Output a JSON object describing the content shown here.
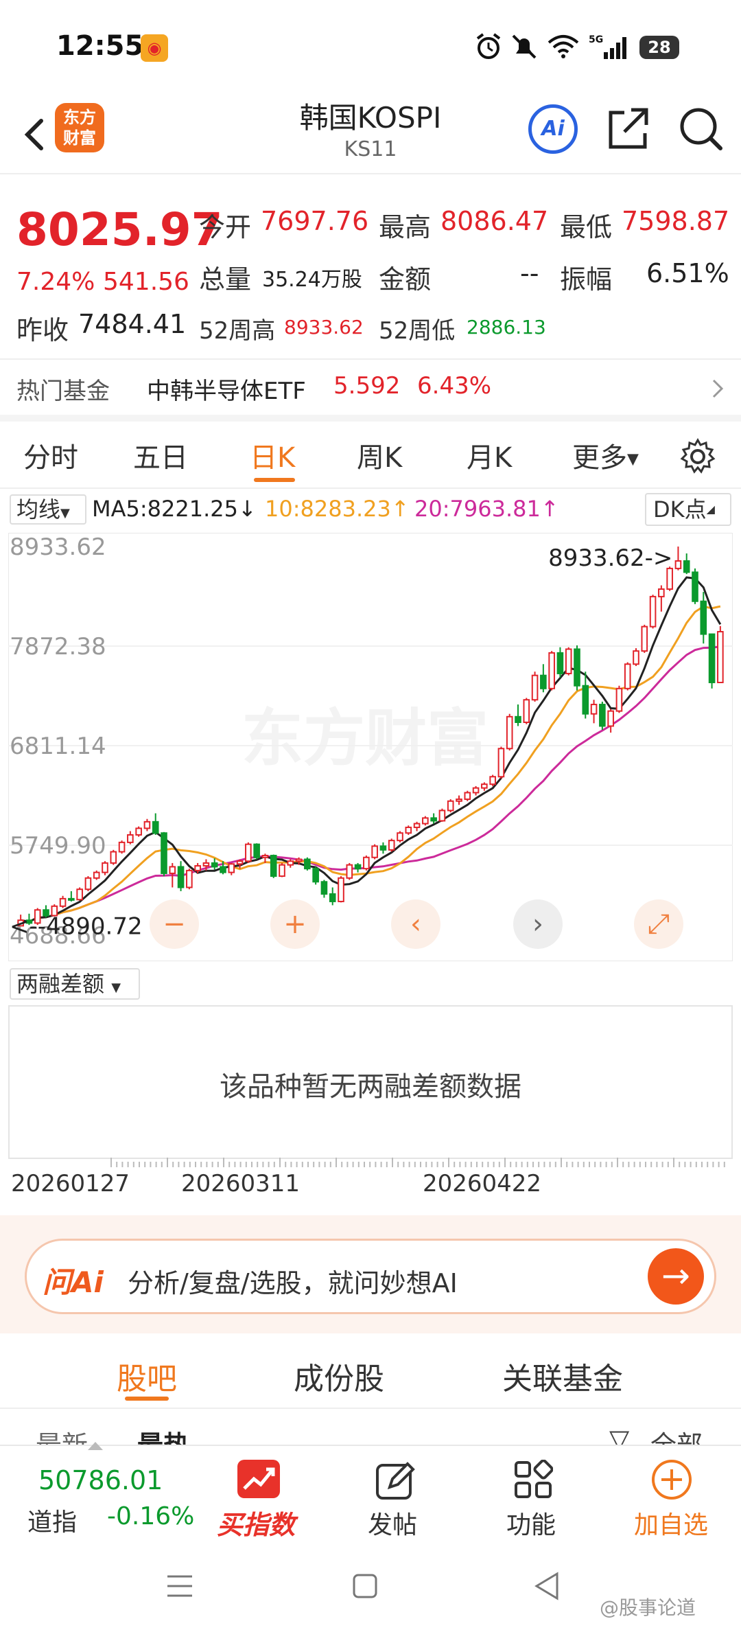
{
  "status_bar": {
    "time": "12:55",
    "battery": "28"
  },
  "header": {
    "logo_text": "东方\n财富",
    "title": "韩国KOSPI",
    "code": "KS11",
    "ai_label": "Ai"
  },
  "quote": {
    "price": "8025.97",
    "change_pct": "7.24%",
    "change_value": "541.56",
    "open_label": "今开",
    "open": "7697.76",
    "high_label": "最高",
    "high": "8086.47",
    "low_label": "最低",
    "low": "7598.87",
    "volume_label": "总量",
    "volume": "35.24万股",
    "amount_label": "金额",
    "amount": "--",
    "amplitude_label": "振幅",
    "amplitude": "6.51%",
    "prev_close_label": "昨收",
    "prev_close": "7484.41",
    "w52_high_label": "52周高",
    "w52_high": "8933.62",
    "w52_low_label": "52周低",
    "w52_low": "2886.13"
  },
  "hot_fund": {
    "label": "热门基金",
    "name": "中韩半导体ETF",
    "price": "5.592",
    "change": "6.43%"
  },
  "period_tabs": [
    "分时",
    "五日",
    "日K",
    "周K",
    "月K",
    "更多"
  ],
  "active_period": "日K",
  "ma_legend": {
    "select_label": "均线",
    "ma5": "MA5:8221.25↓",
    "ma10": "10:8283.23↑",
    "ma20": "20:7963.81↑",
    "dk_label": "DK点"
  },
  "colors": {
    "up": "#e2232a",
    "down": "#0b9a2d",
    "ma5": "#222222",
    "ma10": "#f0a020",
    "ma20": "#cc2a9a",
    "accent": "#f0781e"
  },
  "chart_data": {
    "type": "candlestick",
    "y_ticks": [
      8933.62,
      7872.38,
      6811.14,
      5749.9,
      4688.66
    ],
    "ylim": [
      4688.66,
      8933.62
    ],
    "annotations": [
      {
        "text": "8933.62->",
        "value": 8933.62
      },
      {
        "text": "<--4890.72",
        "value": 4890.72
      }
    ],
    "watermark": "东方财富",
    "candles": [
      [
        4890.72,
        5010,
        4890.72,
        4950
      ],
      [
        4950,
        5020,
        4900,
        4920
      ],
      [
        4920,
        5080,
        4900,
        5060
      ],
      [
        5060,
        5110,
        4980,
        5000
      ],
      [
        5000,
        5120,
        4990,
        5100
      ],
      [
        5100,
        5210,
        5080,
        5180
      ],
      [
        5180,
        5260,
        5150,
        5170
      ],
      [
        5170,
        5300,
        5160,
        5280
      ],
      [
        5280,
        5420,
        5260,
        5400
      ],
      [
        5400,
        5480,
        5380,
        5460
      ],
      [
        5460,
        5580,
        5430,
        5560
      ],
      [
        5560,
        5700,
        5540,
        5680
      ],
      [
        5680,
        5800,
        5660,
        5780
      ],
      [
        5780,
        5900,
        5760,
        5860
      ],
      [
        5860,
        5950,
        5840,
        5930
      ],
      [
        5930,
        6030,
        5900,
        6000
      ],
      [
        6000,
        6090,
        5860,
        5880
      ],
      [
        5880,
        5890,
        5420,
        5450
      ],
      [
        5450,
        5560,
        5300,
        5520
      ],
      [
        5520,
        5580,
        5260,
        5300
      ],
      [
        5300,
        5500,
        5280,
        5480
      ],
      [
        5480,
        5560,
        5450,
        5530
      ],
      [
        5530,
        5600,
        5480,
        5560
      ],
      [
        5560,
        5610,
        5490,
        5520
      ],
      [
        5520,
        5580,
        5440,
        5460
      ],
      [
        5460,
        5560,
        5430,
        5550
      ],
      [
        5550,
        5600,
        5500,
        5580
      ],
      [
        5580,
        5780,
        5560,
        5760
      ],
      [
        5760,
        5770,
        5600,
        5620
      ],
      [
        5620,
        5660,
        5560,
        5640
      ],
      [
        5640,
        5650,
        5400,
        5420
      ],
      [
        5420,
        5560,
        5410,
        5540
      ],
      [
        5540,
        5600,
        5510,
        5580
      ],
      [
        5580,
        5620,
        5540,
        5600
      ],
      [
        5600,
        5620,
        5480,
        5500
      ],
      [
        5500,
        5520,
        5330,
        5360
      ],
      [
        5360,
        5380,
        5190,
        5230
      ],
      [
        5230,
        5300,
        5110,
        5150
      ],
      [
        5150,
        5420,
        5140,
        5400
      ],
      [
        5400,
        5560,
        5380,
        5540
      ],
      [
        5540,
        5560,
        5460,
        5500
      ],
      [
        5500,
        5640,
        5480,
        5620
      ],
      [
        5620,
        5760,
        5600,
        5740
      ],
      [
        5740,
        5780,
        5660,
        5700
      ],
      [
        5700,
        5820,
        5680,
        5800
      ],
      [
        5800,
        5900,
        5780,
        5880
      ],
      [
        5880,
        5960,
        5860,
        5940
      ],
      [
        5940,
        6000,
        5900,
        5980
      ],
      [
        5980,
        6060,
        5960,
        6040
      ],
      [
        6040,
        6090,
        5980,
        6010
      ],
      [
        6010,
        6140,
        6000,
        6120
      ],
      [
        6120,
        6240,
        6100,
        6220
      ],
      [
        6220,
        6280,
        6180,
        6240
      ],
      [
        6240,
        6330,
        6220,
        6310
      ],
      [
        6310,
        6380,
        6280,
        6360
      ],
      [
        6360,
        6420,
        6330,
        6400
      ],
      [
        6400,
        6500,
        6380,
        6480
      ],
      [
        6480,
        6800,
        6460,
        6780
      ],
      [
        6780,
        7150,
        6760,
        7120
      ],
      [
        7120,
        7250,
        7020,
        7060
      ],
      [
        7060,
        7320,
        7040,
        7300
      ],
      [
        7300,
        7600,
        7280,
        7560
      ],
      [
        7560,
        7680,
        7380,
        7420
      ],
      [
        7420,
        7820,
        7400,
        7800
      ],
      [
        7800,
        7860,
        7540,
        7580
      ],
      [
        7580,
        7860,
        7560,
        7840
      ],
      [
        7840,
        7880,
        7400,
        7450
      ],
      [
        7450,
        7600,
        7100,
        7150
      ],
      [
        7150,
        7300,
        7050,
        7250
      ],
      [
        7250,
        7280,
        6980,
        7020
      ],
      [
        7020,
        7200,
        6950,
        7180
      ],
      [
        7180,
        7450,
        7160,
        7420
      ],
      [
        7420,
        7700,
        7400,
        7680
      ],
      [
        7680,
        7850,
        7660,
        7820
      ],
      [
        7820,
        8100,
        7800,
        8080
      ],
      [
        8080,
        8420,
        8060,
        8400
      ],
      [
        8400,
        8520,
        8240,
        8480
      ],
      [
        8480,
        8720,
        8460,
        8700
      ],
      [
        8700,
        8933.62,
        8680,
        8780
      ],
      [
        8780,
        8860,
        8640,
        8660
      ],
      [
        8660,
        8700,
        8320,
        8350
      ],
      [
        8350,
        8450,
        7900,
        8000
      ],
      [
        8000,
        7900,
        7420,
        7484.41
      ],
      [
        7484.41,
        8086.47,
        7598.87,
        8025.97
      ]
    ]
  },
  "chart_buttons": [
    "−",
    "+",
    "‹",
    "›",
    "⤢"
  ],
  "margin": {
    "select_label": "两融差额",
    "empty_text": "该品种暂无两融差额数据"
  },
  "dates": [
    "20260127",
    "20260311",
    "20260422"
  ],
  "ai_bar": {
    "brand": "问Ai",
    "prompt": "分析/复盘/选股，就问妙想AI"
  },
  "section_tabs": [
    "股吧",
    "成份股",
    "关联基金"
  ],
  "sub_tabs": {
    "latest": "最新",
    "hot": "最热",
    "all": "全部"
  },
  "bottom_nav": {
    "index_value": "50786.01",
    "index_name": "道指",
    "index_change": "-0.16%",
    "buy_label": "买指数",
    "post_label": "发帖",
    "func_label": "功能",
    "add_label": "加自选"
  },
  "watermark_corner": "@股事论道"
}
